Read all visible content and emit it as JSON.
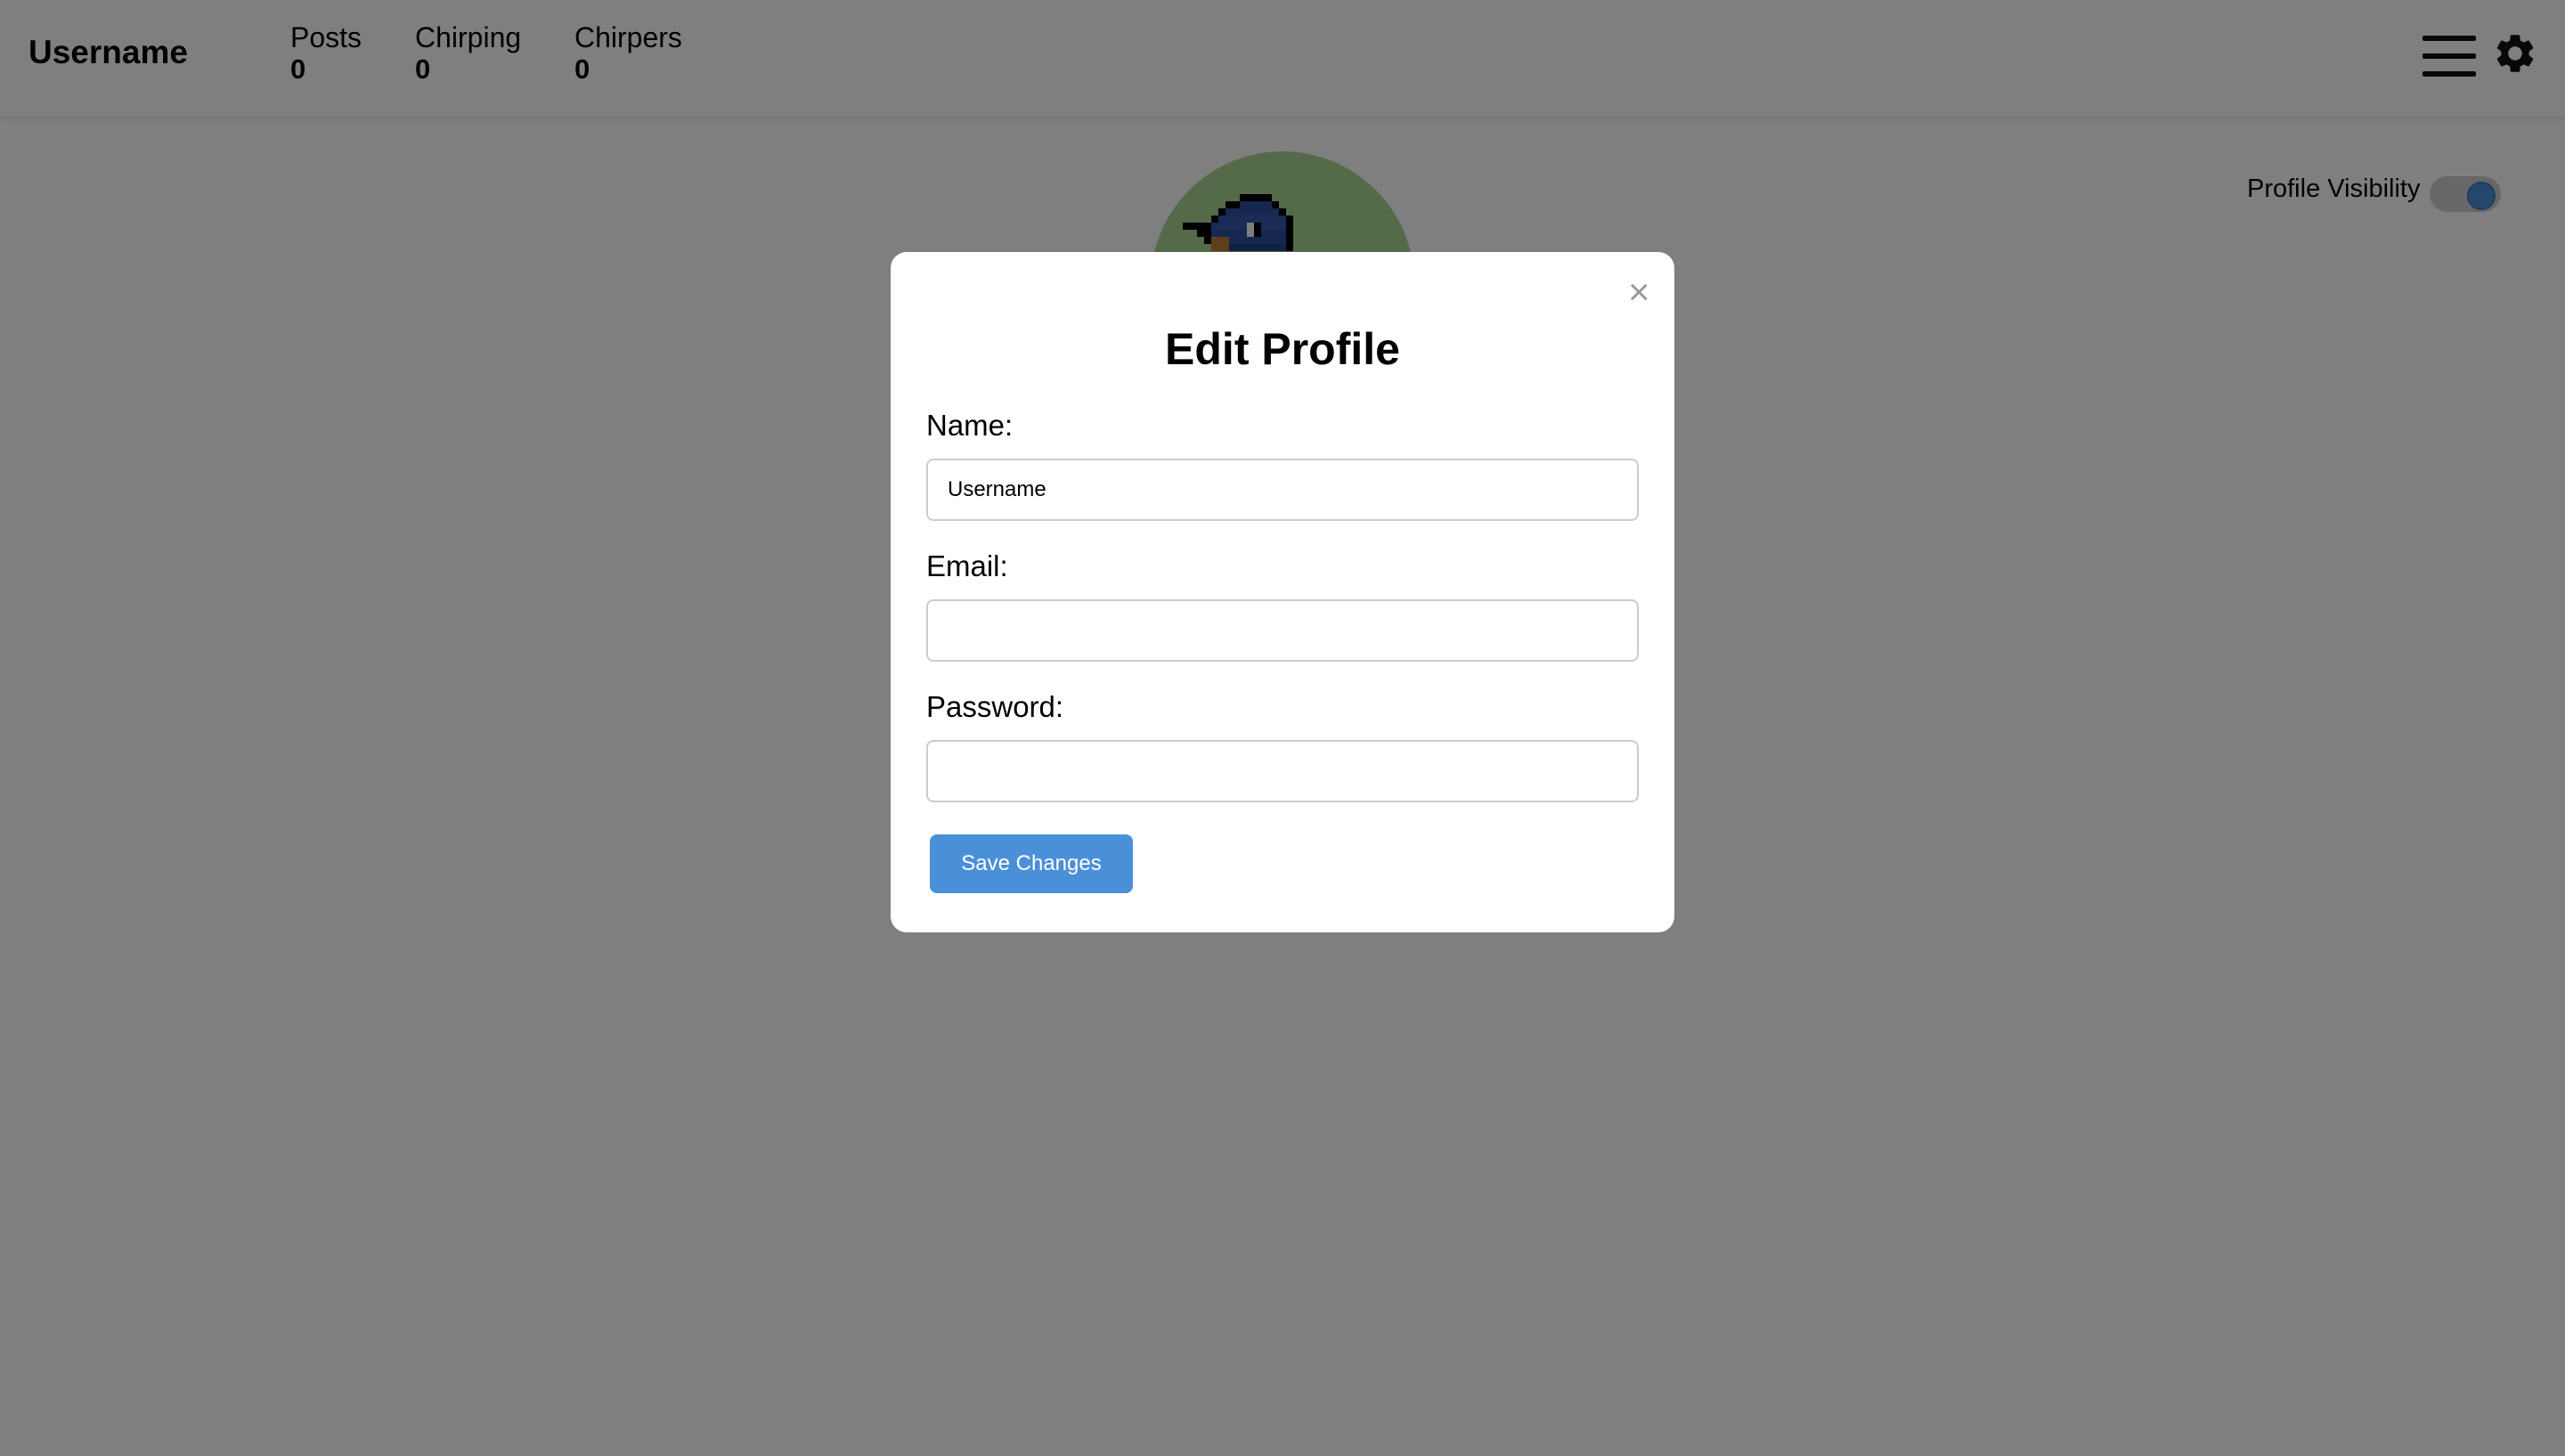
{
  "header": {
    "username": "Username",
    "stats": [
      {
        "label": "Posts",
        "value": "0"
      },
      {
        "label": "Chirping",
        "value": "0"
      },
      {
        "label": "Chirpers",
        "value": "0"
      }
    ],
    "icons": [
      "menu-icon",
      "gear-icon"
    ]
  },
  "profile": {
    "visibility_label": "Profile Visibility",
    "visibility_on": true
  },
  "modal": {
    "title": "Edit Profile",
    "close_glyph": "×",
    "name_label": "Name:",
    "name_value": "Username",
    "email_label": "Email:",
    "email_value": "",
    "password_label": "Password:",
    "password_value": "",
    "save_label": "Save Changes"
  },
  "colors": {
    "accent": "#4a90d9",
    "overlay": "rgba(0,0,0,0.5)",
    "avatar_bg": "#a9d493"
  }
}
